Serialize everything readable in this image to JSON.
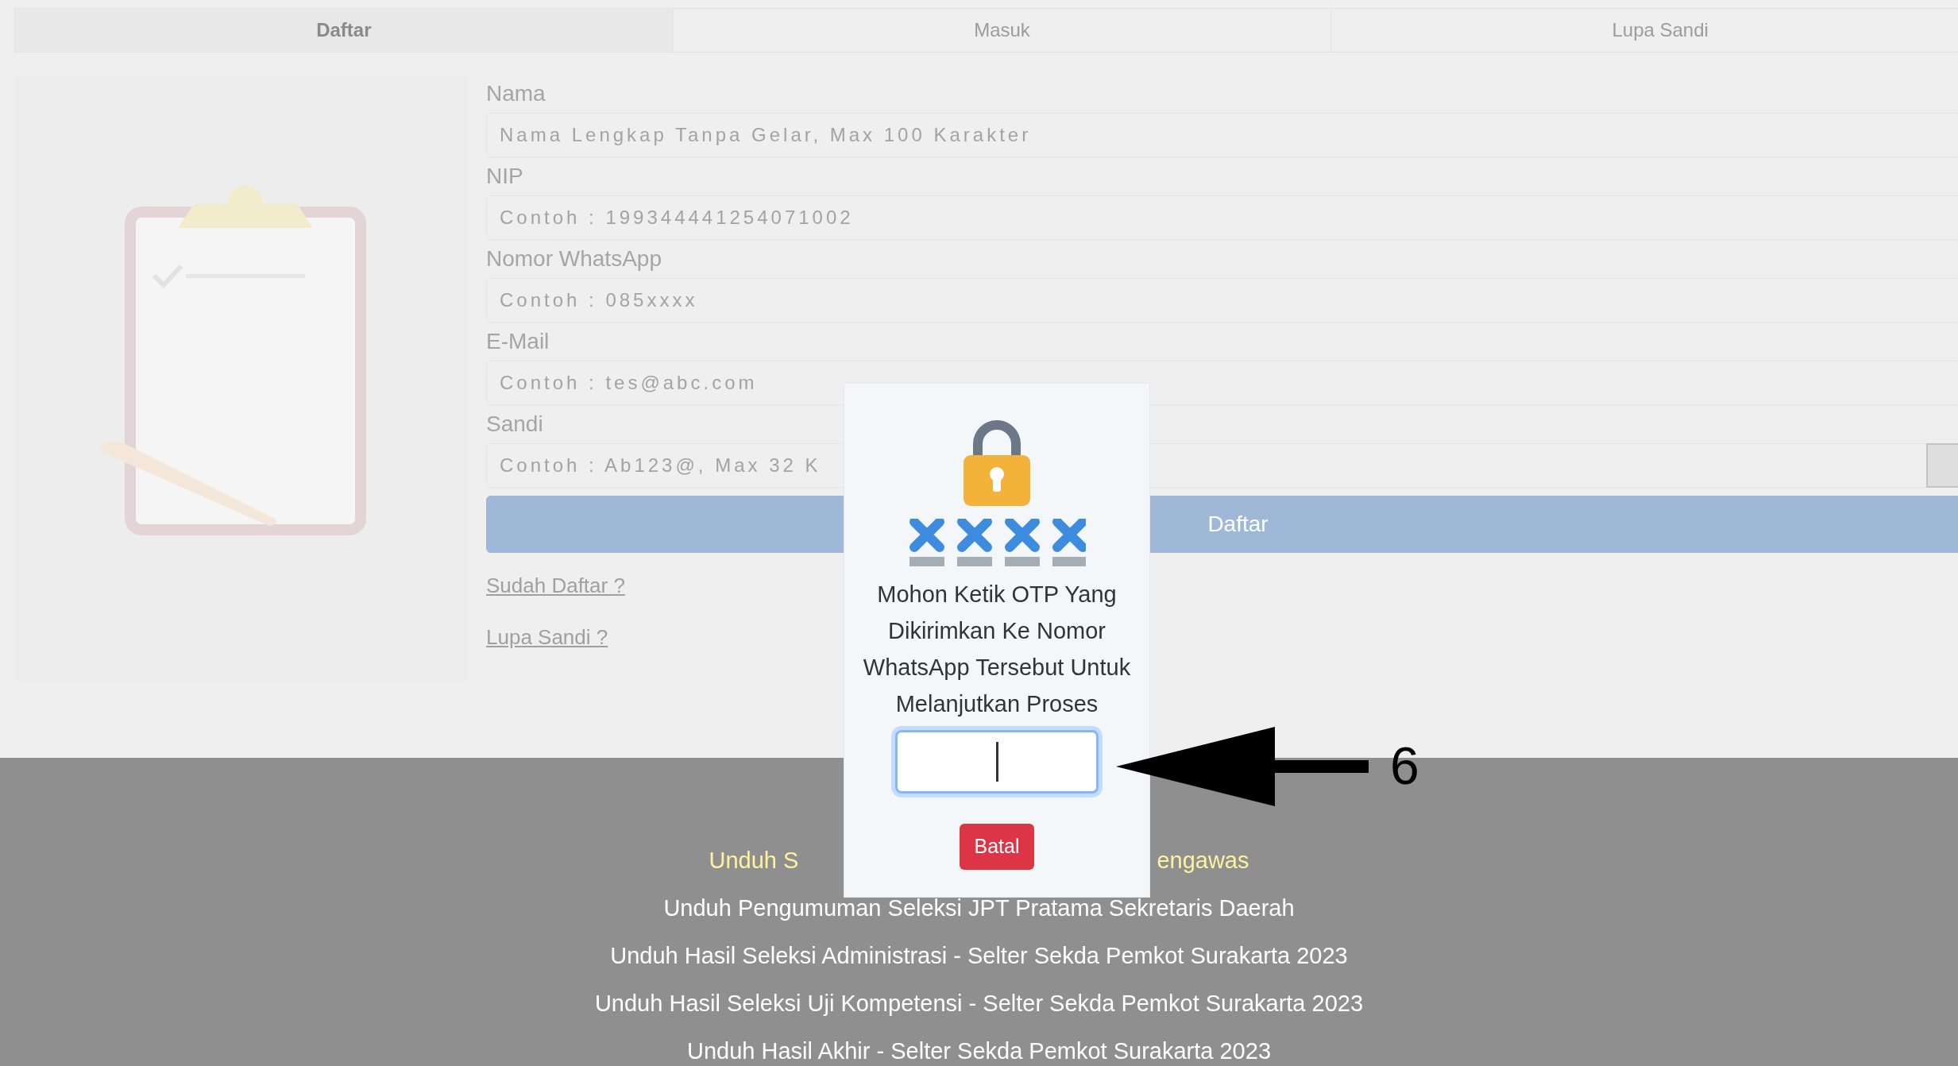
{
  "tabs": [
    {
      "label": "Daftar",
      "selected": true
    },
    {
      "label": "Masuk",
      "selected": false
    },
    {
      "label": "Lupa Sandi",
      "selected": false
    }
  ],
  "form": {
    "fields": [
      {
        "label": "Nama",
        "placeholder": "Nama Lengkap Tanpa Gelar, Max 100 Karakter",
        "kind": "text"
      },
      {
        "label": "NIP",
        "placeholder": "Contoh : 199344441254071002",
        "kind": "text"
      },
      {
        "label": "Nomor WhatsApp",
        "placeholder": "Contoh : 085xxxx",
        "kind": "text"
      },
      {
        "label": "E-Mail",
        "placeholder": "Contoh : tes@abc.com",
        "kind": "text"
      },
      {
        "label": "Sandi",
        "placeholder": "Contoh : Ab123@, Max 32 K",
        "kind": "password"
      }
    ],
    "submit": "Daftar",
    "links": [
      "Sudah Daftar ?",
      "Lupa Sandi ?"
    ]
  },
  "footer_links": [
    {
      "parts": [
        "Unduh S",
        "engawas"
      ],
      "highlighted": true
    },
    {
      "parts": [
        "Unduh Pengumuman Seleksi JPT Pratama Sekretaris Daerah"
      ],
      "highlighted": false
    },
    {
      "parts": [
        "Unduh Hasil Seleksi Administrasi - Selter Sekda Pemkot Surakarta 2023"
      ],
      "highlighted": false
    },
    {
      "parts": [
        "Unduh Hasil Seleksi Uji Kompetensi - Selter Sekda Pemkot Surakarta 2023"
      ],
      "highlighted": false
    },
    {
      "parts": [
        "Unduh Hasil Akhir - Selter Sekda Pemkot Surakarta 2023"
      ],
      "highlighted": false
    }
  ],
  "otp_dialog": {
    "message": "Mohon Ketik OTP Yang Dikirimkan Ke Nomor WhatsApp Tersebut Untuk Melanjutkan Proses",
    "otp_field": {
      "focused": true
    },
    "cancel": "Batal"
  },
  "annotation": {
    "label": "6"
  }
}
